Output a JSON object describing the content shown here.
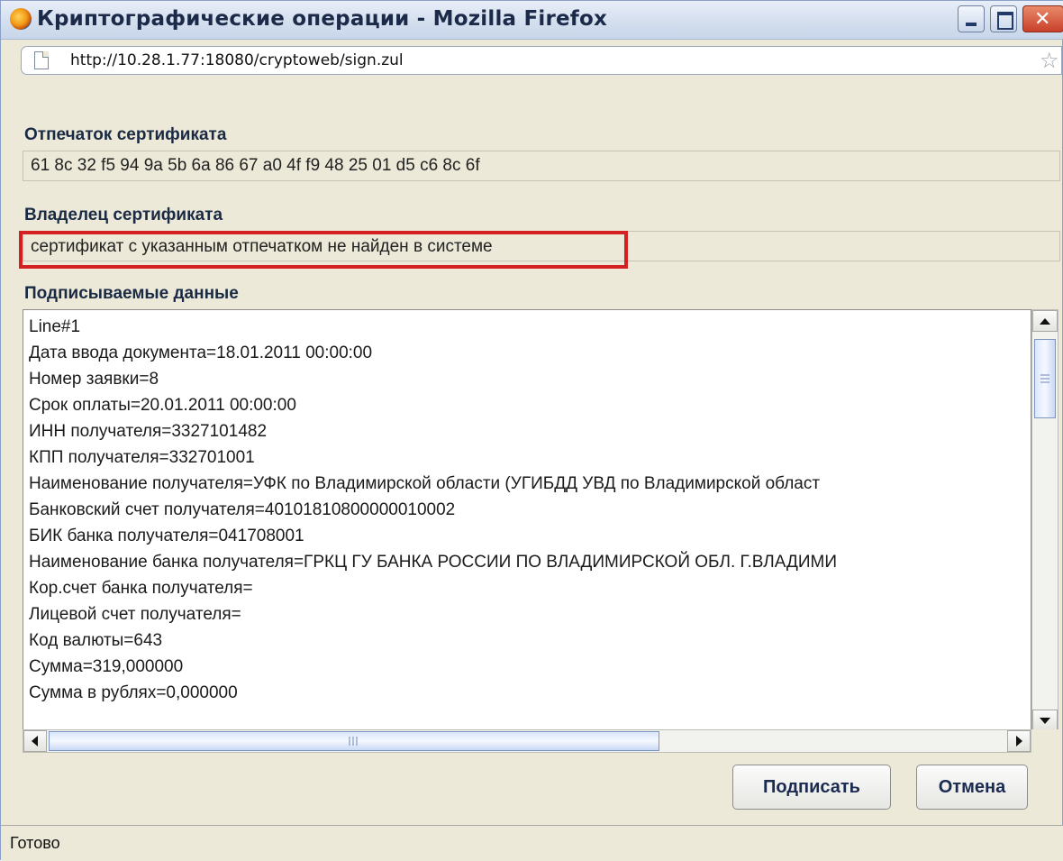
{
  "window": {
    "title": "Криптографические операции - Mozilla Firefox",
    "url": "http://10.28.1.77:18080/cryptoweb/sign.zul"
  },
  "fingerprint": {
    "label": "Отпечаток сертификата",
    "value": "61 8c 32 f5 94 9a 5b 6a 86 67 a0 4f f9 48 25 01 d5 c6 8c 6f"
  },
  "owner": {
    "label": "Владелец сертификата",
    "value": "сертификат с указанным отпечатком не найден в системе",
    "highlight_color": "#d42020"
  },
  "signed_data": {
    "label": "Подписываемые данные",
    "lines": [
      "Line#1",
      "Дата ввода документа=18.01.2011 00:00:00",
      "Номер заявки=8",
      "Срок оплаты=20.01.2011 00:00:00",
      "ИНН получателя=3327101482",
      "КПП получателя=332701001",
      "Наименование получателя=УФК по Владимирской области (УГИБДД УВД по Владимирской област",
      "Банковский счет получателя=40101810800000010002",
      "БИК банка получателя=041708001",
      "Наименование банка получателя=ГРКЦ ГУ БАНКА РОССИИ ПО ВЛАДИМИРСКОЙ ОБЛ. Г.ВЛАДИМИ",
      "Кор.счет банка получателя=",
      "Лицевой счет получателя=",
      "Код валюты=643",
      "Сумма=319,000000",
      "Сумма в рублях=0,000000"
    ]
  },
  "buttons": {
    "sign": "Подписать",
    "cancel": "Отмена"
  },
  "status": {
    "text": "Готово"
  },
  "icons": {
    "app": "firefox-icon",
    "page": "page-icon",
    "bookmark": "star-icon"
  }
}
